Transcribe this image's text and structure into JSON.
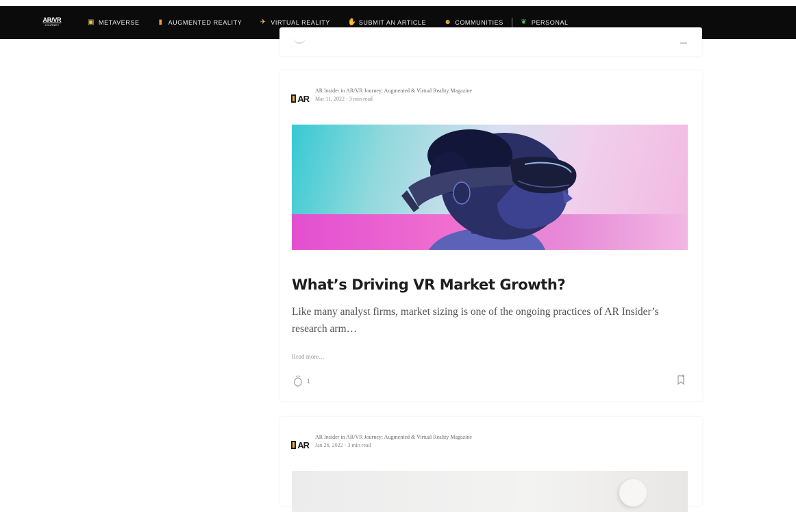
{
  "nav": {
    "logo_top": "AR/VR",
    "logo_bottom": "JOURNEY",
    "items": [
      {
        "label": "Metaverse",
        "icon": "cube-icon",
        "icon_char": "▣",
        "icon_color": "#f2c463"
      },
      {
        "label": "Augmented Reality",
        "icon": "candle-icon",
        "icon_char": "▮",
        "icon_color": "#f09a2b"
      },
      {
        "label": "Virtual Reality",
        "icon": "airplane-icon",
        "icon_char": "✈",
        "icon_color": "#f3c23b"
      },
      {
        "label": "Submit an Article",
        "icon": "hand-icon",
        "icon_char": "✋",
        "icon_color": "#f4c542"
      },
      {
        "label": "Communities",
        "icon": "group-icon",
        "icon_char": "☻",
        "icon_color": "#f4b53c"
      },
      {
        "label": "Personal",
        "icon": "leaf-icon",
        "icon_char": "❦",
        "icon_color": "#66c36a"
      }
    ]
  },
  "posts": [
    {
      "author_line": "AR Insider in AR/VR Journey: Augmented & Virtual Reality Magazine",
      "date_line": "Mar 11, 2022 · 3 min read",
      "title": "What’s Driving VR Market Growth?",
      "subtitle": "Like many analyst firms, market sizing is one of the ongoing practices of AR Insider’s research arm…",
      "read_more": "Read more…",
      "claps": "1"
    },
    {
      "author_line": "AR Insider in AR/VR Journey: Augmented & Virtual Reality Magazine",
      "date_line": "Jan 26, 2022 · 3 min read"
    }
  ],
  "publication_logo_text": "AR",
  "colors": {
    "nav_bg": "#0b0b0b",
    "accent_yellow": "#f0b534"
  }
}
